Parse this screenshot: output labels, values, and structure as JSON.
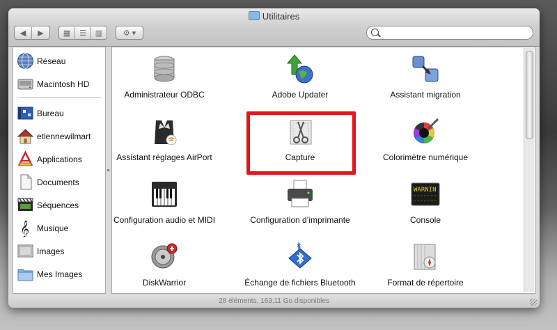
{
  "window": {
    "title": "Utilitaires"
  },
  "toolbar": {
    "back_label": "◀",
    "forward_label": "▶",
    "view_icon_label": "▦",
    "view_list_label": "☰",
    "view_column_label": "▥",
    "action_label": "⚙ ▾"
  },
  "search": {
    "value": "",
    "placeholder": ""
  },
  "sidebar": {
    "items": [
      {
        "label": "Réseau",
        "icon": "globe-icon"
      },
      {
        "label": "Macintosh HD",
        "icon": "hard-drive-icon"
      },
      {
        "label": "Bureau",
        "icon": "desktop-icon"
      },
      {
        "label": "etiennewilmart",
        "icon": "home-icon"
      },
      {
        "label": "Applications",
        "icon": "applications-icon"
      },
      {
        "label": "Documents",
        "icon": "documents-icon"
      },
      {
        "label": "Séquences",
        "icon": "film-icon"
      },
      {
        "label": "Musique",
        "icon": "music-icon"
      },
      {
        "label": "Images",
        "icon": "pictures-icon"
      },
      {
        "label": "Mes Images",
        "icon": "folder-icon"
      }
    ]
  },
  "main": {
    "items": [
      {
        "label": "Administrateur ODBC",
        "icon": "database-icon"
      },
      {
        "label": "Adobe Updater",
        "icon": "adobe-updater-icon"
      },
      {
        "label": "Assistant migration",
        "icon": "migration-icon"
      },
      {
        "label": "Assistant réglages AirPort",
        "icon": "airport-icon"
      },
      {
        "label": "Capture",
        "icon": "capture-icon"
      },
      {
        "label": "Colorimètre numérique",
        "icon": "colorimeter-icon"
      },
      {
        "label": "Configuration audio et MIDI",
        "icon": "piano-icon"
      },
      {
        "label": "Configuration d’imprimante",
        "icon": "printer-icon"
      },
      {
        "label": "Console",
        "icon": "console-icon"
      },
      {
        "label": "DiskWarrior",
        "icon": "diskwarrior-icon"
      },
      {
        "label": "Échange de fichiers Bluetooth",
        "icon": "bluetooth-icon"
      },
      {
        "label": "Format de répertoire",
        "icon": "directory-icon"
      }
    ],
    "console_text": "WARNIN"
  },
  "status": {
    "text": "28 éléments, 163,11 Go disponibles"
  },
  "colors": {
    "highlight": "#e8121a",
    "folder": "#8cb6e6"
  }
}
